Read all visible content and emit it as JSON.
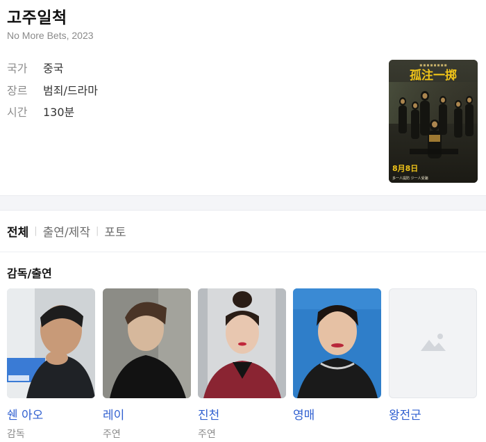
{
  "movie": {
    "title": "고주일척",
    "subtitle": "No More Bets, 2023",
    "info": [
      {
        "label": "국가",
        "value": "중국"
      },
      {
        "label": "장르",
        "value": "범죄/드라마"
      },
      {
        "label": "시간",
        "value": "130분"
      }
    ],
    "poster": {
      "title_text": "孤注一掷",
      "date_text": "8月8日",
      "tagline": "多一人提防 少一人受骗"
    }
  },
  "tabs": [
    {
      "label": "전체",
      "active": true
    },
    {
      "label": "출연/제작",
      "active": false
    },
    {
      "label": "포토",
      "active": false
    }
  ],
  "cast_section": {
    "heading": "감독/출연",
    "members": [
      {
        "name": "쉔 아오",
        "role": "감독"
      },
      {
        "name": "레이",
        "role": "주연"
      },
      {
        "name": "진천",
        "role": "주연"
      },
      {
        "name": "영매",
        "role": ""
      },
      {
        "name": "왕전군",
        "role": ""
      }
    ]
  },
  "colors": {
    "link": "#2f5fd0",
    "label": "#8c8c8c",
    "poster_title": "#f0c419"
  },
  "icons": {
    "placeholder": "image-placeholder-icon"
  }
}
